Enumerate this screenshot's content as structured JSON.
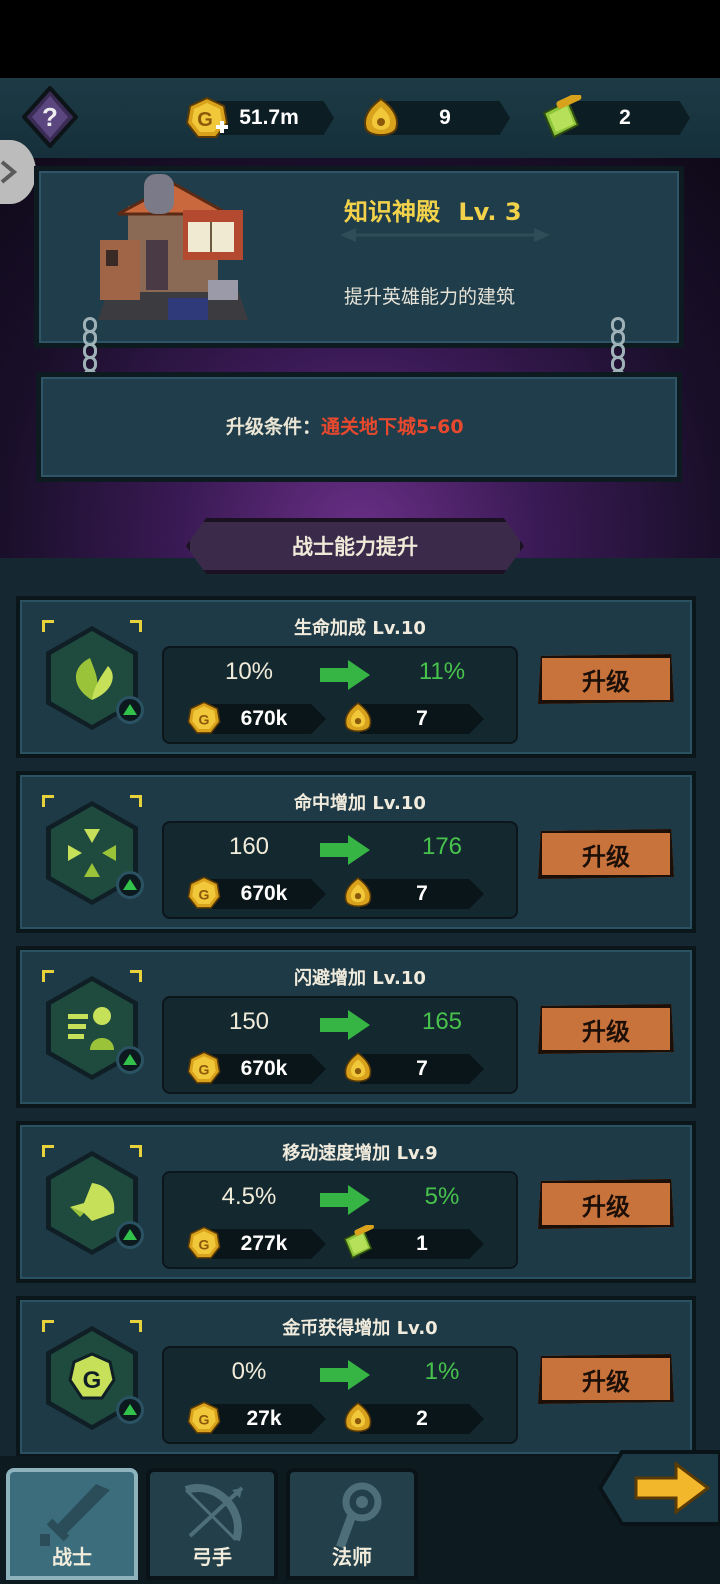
{
  "resources": {
    "gold": "51.7m",
    "token": "9",
    "scroll": "2"
  },
  "building": {
    "title": "知识神殿",
    "level": "Lv. 3",
    "description": "提升英雄能力的建筑",
    "upgrade_label": "升级条件：",
    "upgrade_requirement": "通关地下城5-60"
  },
  "section_title": "战士能力提升",
  "abilities": [
    {
      "name": "生命加成 Lv.10",
      "current": "10%",
      "next": "11%",
      "gold_cost": "670k",
      "item_cost": "7",
      "item_icon": "token-icon",
      "button": "升级",
      "icon": "leaf-icon"
    },
    {
      "name": "命中增加 Lv.10",
      "current": "160",
      "next": "176",
      "gold_cost": "670k",
      "item_cost": "7",
      "item_icon": "token-icon",
      "button": "升级",
      "icon": "target-icon"
    },
    {
      "name": "闪避增加 Lv.10",
      "current": "150",
      "next": "165",
      "gold_cost": "670k",
      "item_cost": "7",
      "item_icon": "token-icon",
      "button": "升级",
      "icon": "dodge-icon"
    },
    {
      "name": "移动速度增加 Lv.9",
      "current": "4.5%",
      "next": "5%",
      "gold_cost": "277k",
      "item_cost": "1",
      "item_icon": "scroll-icon",
      "button": "升级",
      "icon": "wing-boot-icon"
    },
    {
      "name": "金币获得增加 Lv.0",
      "current": "0%",
      "next": "1%",
      "gold_cost": "27k",
      "item_cost": "2",
      "item_icon": "token-icon",
      "button": "升级",
      "icon": "gold-coin-icon"
    }
  ],
  "tabs": [
    {
      "label": "战士",
      "icon": "sword-icon",
      "active": true
    },
    {
      "label": "弓手",
      "icon": "bow-icon",
      "active": false
    },
    {
      "label": "法师",
      "icon": "staff-icon",
      "active": false
    }
  ],
  "colors": {
    "accent_yellow": "#f3d24b",
    "requirement_red": "#e8492e",
    "increase_green": "#47c34c",
    "button_orange": "#c9733c"
  }
}
